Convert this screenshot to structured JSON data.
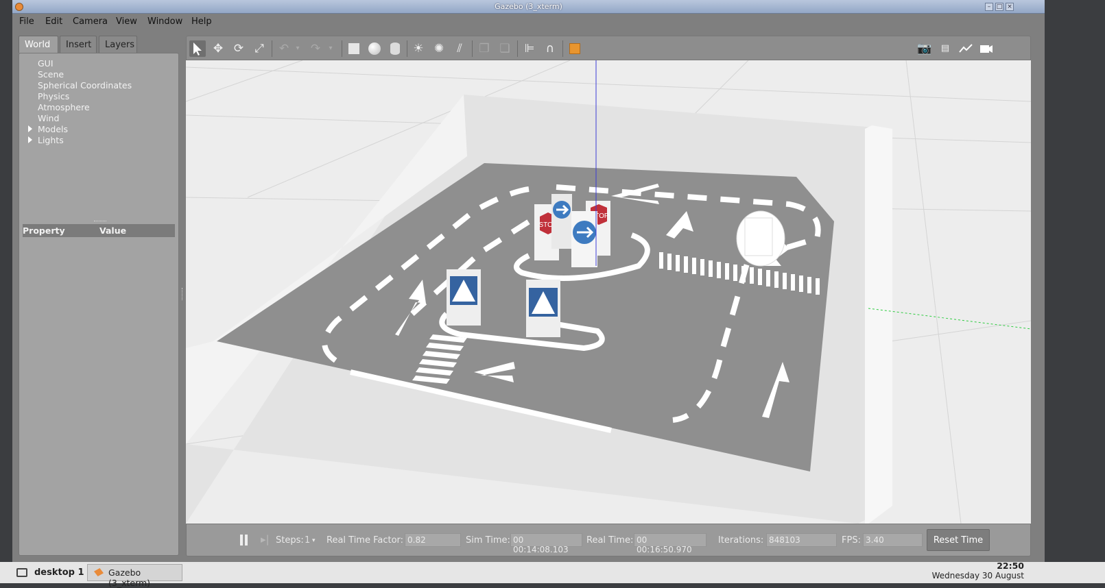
{
  "window": {
    "title": "Gazebo (3_xterm)"
  },
  "menu": [
    "File",
    "Edit",
    "Camera",
    "View",
    "Window",
    "Help"
  ],
  "left_tabs": [
    {
      "label": "World",
      "active": true
    },
    {
      "label": "Insert",
      "active": false
    },
    {
      "label": "Layers",
      "active": false
    }
  ],
  "world_tree": [
    {
      "label": "GUI",
      "expandable": false
    },
    {
      "label": "Scene",
      "expandable": false
    },
    {
      "label": "Spherical Coordinates",
      "expandable": false
    },
    {
      "label": "Physics",
      "expandable": false
    },
    {
      "label": "Atmosphere",
      "expandable": false
    },
    {
      "label": "Wind",
      "expandable": false
    },
    {
      "label": "Models",
      "expandable": true
    },
    {
      "label": "Lights",
      "expandable": true
    }
  ],
  "property_table": {
    "col_property": "Property",
    "col_value": "Value"
  },
  "toolbar_icons": [
    "select-icon",
    "translate-icon",
    "rotate-icon",
    "scale-icon",
    "undo-icon",
    "redo-icon",
    "box-icon",
    "sphere-icon",
    "cylinder-icon",
    "point-light-icon",
    "spot-light-icon",
    "directional-light-icon",
    "copy-icon",
    "paste-icon",
    "align-icon",
    "snap-icon",
    "view-angle-icon",
    "screenshot-icon",
    "log-icon",
    "plot-icon",
    "record-icon"
  ],
  "scene": {
    "signs": [
      "STOP",
      "STOP"
    ]
  },
  "bottom": {
    "steps_label": "Steps:",
    "steps_value": "1",
    "rtf_label": "Real Time Factor:",
    "rtf_value": "0.82",
    "sim_label": "Sim Time:",
    "sim_value": "00 00:14:08.103",
    "real_label": "Real Time:",
    "real_value": "00 00:16:50.970",
    "iter_label": "Iterations:",
    "iter_value": "848103",
    "fps_label": "FPS:",
    "fps_value": "3.40",
    "reset_label": "Reset Time"
  },
  "taskbar": {
    "desktop": "desktop 1",
    "task": "Gazebo (3_xterm)",
    "time": "22:50",
    "date": "Wednesday 30 August"
  },
  "colors": {
    "title_bar": "#93a7c6",
    "panel": "#a3a3a3",
    "viewport_bg": "#ececec",
    "road": "#8f8f8f"
  }
}
